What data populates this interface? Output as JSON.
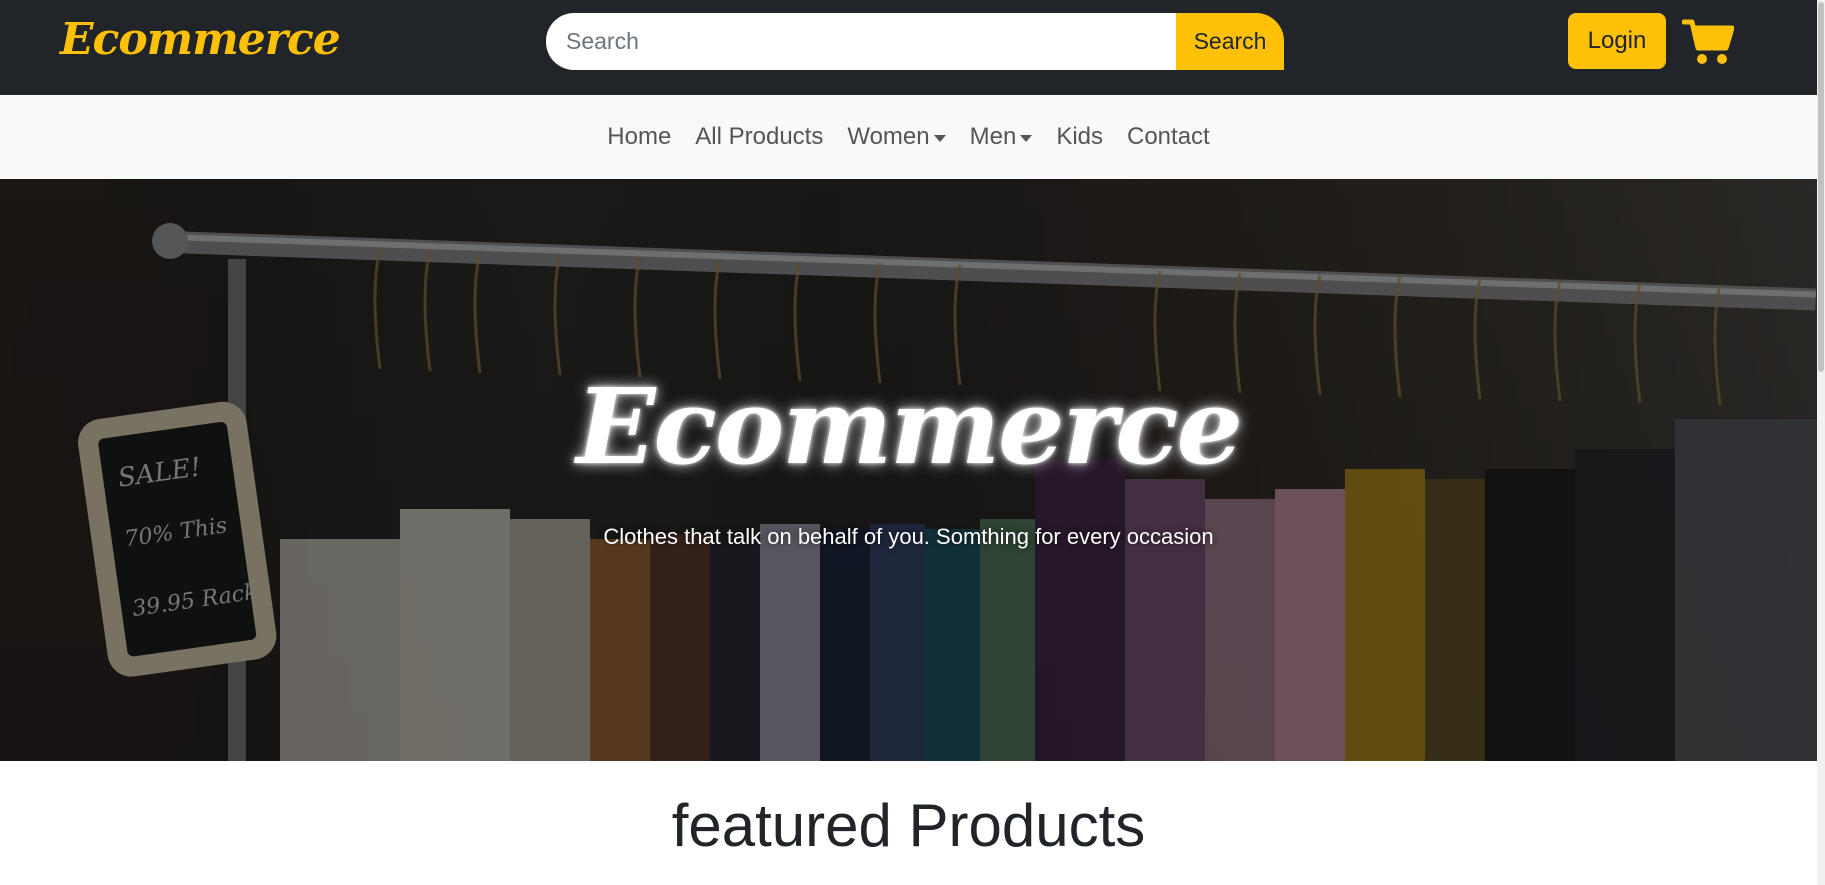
{
  "header": {
    "brand": "Ecommerce",
    "search_placeholder": "Search",
    "search_button": "Search",
    "login_button": "Login",
    "cart_icon": "shopping-cart-icon"
  },
  "nav": {
    "items": [
      {
        "label": "Home",
        "dropdown": false
      },
      {
        "label": "All Products",
        "dropdown": false
      },
      {
        "label": "Women",
        "dropdown": true
      },
      {
        "label": "Men",
        "dropdown": true
      },
      {
        "label": "Kids",
        "dropdown": false
      },
      {
        "label": "Contact",
        "dropdown": false
      }
    ]
  },
  "hero": {
    "title": "Ecommerce",
    "subtitle": "Clothes that talk on behalf of you. Somthing for every occasion",
    "sign_text": [
      "SALE!",
      "70% This",
      "39.95 Rack"
    ]
  },
  "featured": {
    "title": "featured Products"
  },
  "colors": {
    "accent": "#ffc107",
    "header_bg": "#212529",
    "nav_bg": "#f8f9fa"
  }
}
